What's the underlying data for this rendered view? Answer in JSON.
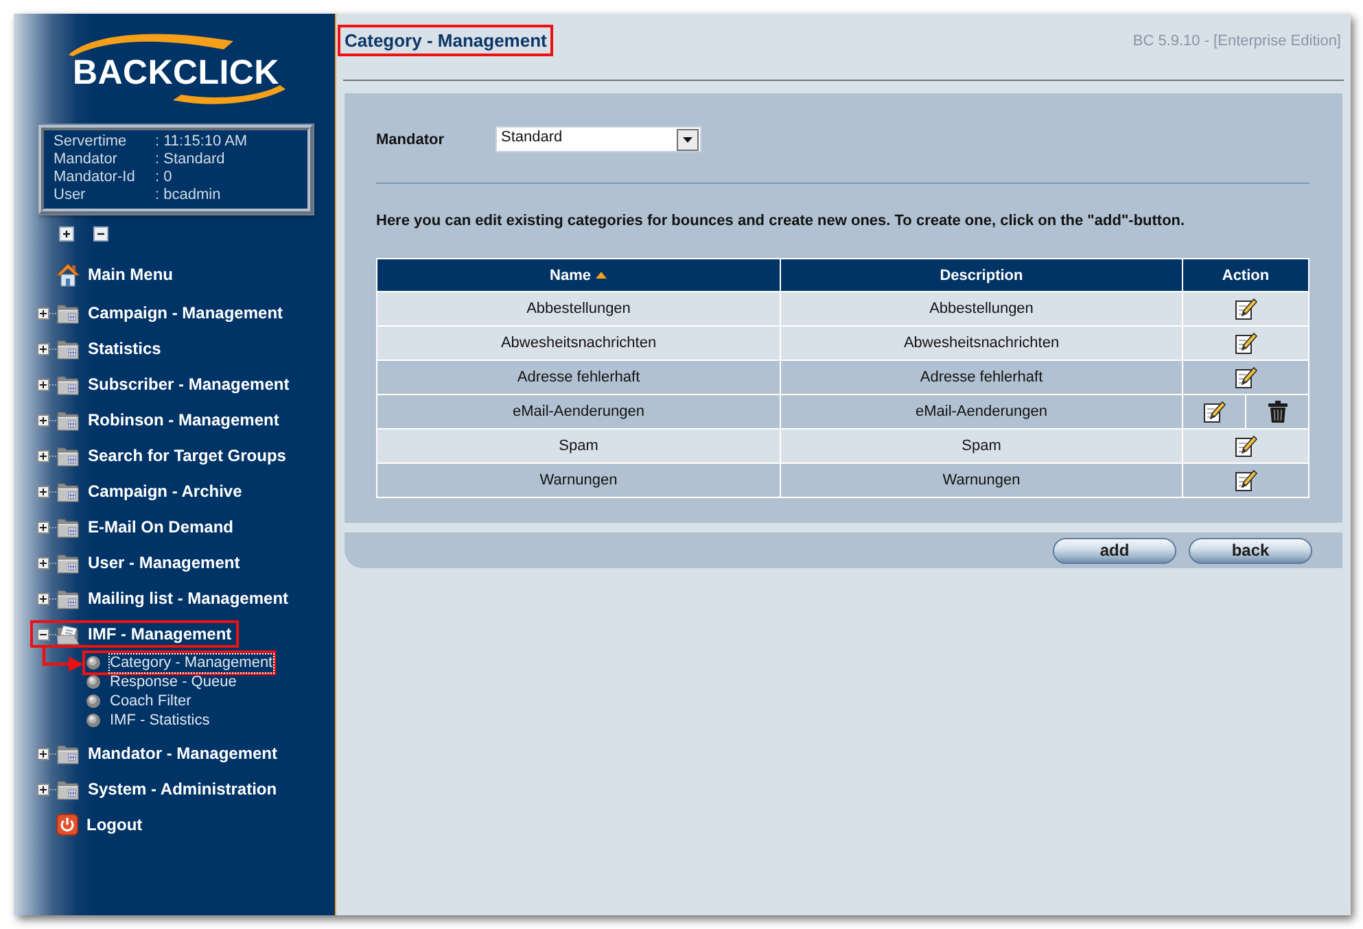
{
  "sidebar": {
    "logo": "BACKCLICK",
    "server_info": [
      {
        "label": "Servertime",
        "value": ": 11:15:10 AM"
      },
      {
        "label": "Mandator",
        "value": ": Standard"
      },
      {
        "label": "Mandator-Id",
        "value": ": 0"
      },
      {
        "label": "User",
        "value": ": bcadmin"
      }
    ],
    "menu": [
      {
        "kind": "home",
        "label": "Main Menu",
        "highlighted": false
      },
      {
        "kind": "folder",
        "label": "Campaign - Management",
        "expanded": false,
        "highlighted": false
      },
      {
        "kind": "folder",
        "label": "Statistics",
        "expanded": false,
        "highlighted": false
      },
      {
        "kind": "folder",
        "label": "Subscriber - Management",
        "expanded": false,
        "highlighted": false
      },
      {
        "kind": "folder",
        "label": "Robinson - Management",
        "expanded": false,
        "highlighted": false
      },
      {
        "kind": "folder",
        "label": "Search for Target Groups",
        "expanded": false,
        "highlighted": false
      },
      {
        "kind": "folder",
        "label": "Campaign - Archive",
        "expanded": false,
        "highlighted": false
      },
      {
        "kind": "folder",
        "label": "E-Mail On Demand",
        "expanded": false,
        "highlighted": false
      },
      {
        "kind": "folder",
        "label": "User - Management",
        "expanded": false,
        "highlighted": false
      },
      {
        "kind": "folder",
        "label": "Mailing list - Management",
        "expanded": false,
        "highlighted": false
      },
      {
        "kind": "folder",
        "label": "IMF - Management",
        "expanded": true,
        "highlighted": true,
        "children": [
          {
            "label": "Category - Management",
            "selected": true,
            "highlighted": true,
            "arrow": true
          },
          {
            "label": "Response - Queue",
            "selected": false,
            "highlighted": false,
            "arrow": false
          },
          {
            "label": "Coach Filter",
            "selected": false,
            "highlighted": false,
            "arrow": false
          },
          {
            "label": "IMF - Statistics",
            "selected": false,
            "highlighted": false,
            "arrow": false
          }
        ]
      },
      {
        "kind": "folder",
        "label": "Mandator - Management",
        "expanded": false,
        "highlighted": false
      },
      {
        "kind": "folder",
        "label": "System - Administration",
        "expanded": false,
        "highlighted": false
      },
      {
        "kind": "logout",
        "label": "Logout",
        "highlighted": false
      }
    ]
  },
  "header": {
    "title": "Category - Management",
    "title_highlighted": true,
    "version": "BC 5.9.10 - [Enterprise Edition]"
  },
  "mandator": {
    "label": "Mandator",
    "value": "Standard"
  },
  "instruction": "Here you can edit existing categories for bounces and create new ones. To create one, click on the \"add\"-button.",
  "table": {
    "columns": [
      {
        "label": "Name",
        "sorted": true
      },
      {
        "label": "Description",
        "sorted": false
      },
      {
        "label": "Action",
        "sorted": false
      }
    ],
    "rows": [
      {
        "name": "Abbestellungen",
        "description": "Abbestellungen",
        "shaded": false,
        "deletable": false
      },
      {
        "name": "Abwesheitsnachrichten",
        "description": "Abwesheitsnachrichten",
        "shaded": false,
        "deletable": false
      },
      {
        "name": "Adresse fehlerhaft",
        "description": "Adresse fehlerhaft",
        "shaded": true,
        "deletable": false
      },
      {
        "name": "eMail-Aenderungen",
        "description": "eMail-Aenderungen",
        "shaded": true,
        "deletable": true
      },
      {
        "name": "Spam",
        "description": "Spam",
        "shaded": false,
        "deletable": false
      },
      {
        "name": "Warnungen",
        "description": "Warnungen",
        "shaded": true,
        "deletable": false
      }
    ]
  },
  "buttons": [
    "add",
    "back"
  ]
}
